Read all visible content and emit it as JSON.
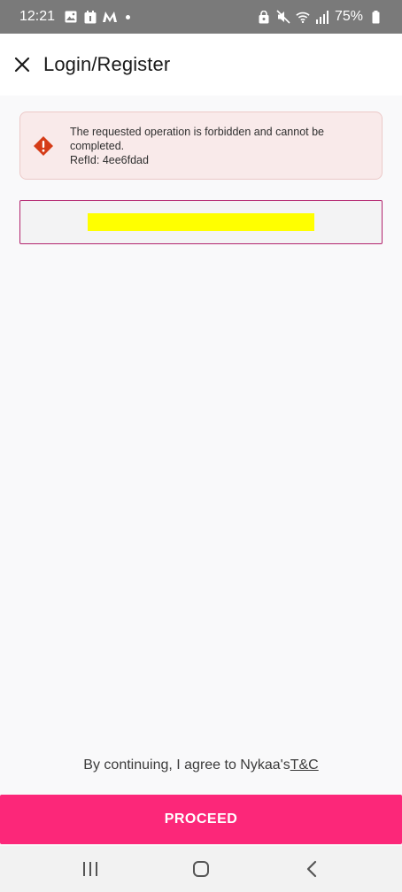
{
  "status_bar": {
    "time": "12:21",
    "battery": "75%",
    "icons": [
      "gallery-icon",
      "calendar-icon",
      "myntra-icon",
      "notification-dot",
      "lock-icon",
      "mute-icon",
      "wifi-icon",
      "signal-icon",
      "battery-icon"
    ]
  },
  "header": {
    "close_icon": "close-icon",
    "title": "Login/Register"
  },
  "error": {
    "icon": "warning-icon",
    "line1": "The requested operation is forbidden and cannot be",
    "line2": "completed.",
    "line3": "RefId: 4ee6fdad",
    "colors": {
      "background": "#f9eaea",
      "border": "#ecc9c8",
      "icon": "#d53c18"
    }
  },
  "phone_input": {
    "value": ""
  },
  "terms": {
    "text": "By continuing, I agree to Nykaa's",
    "link": "T&C"
  },
  "proceed": {
    "label": "PROCEED",
    "color": "#fc2779"
  },
  "nav": {
    "icons": [
      "recents-icon",
      "home-icon",
      "back-icon"
    ]
  }
}
